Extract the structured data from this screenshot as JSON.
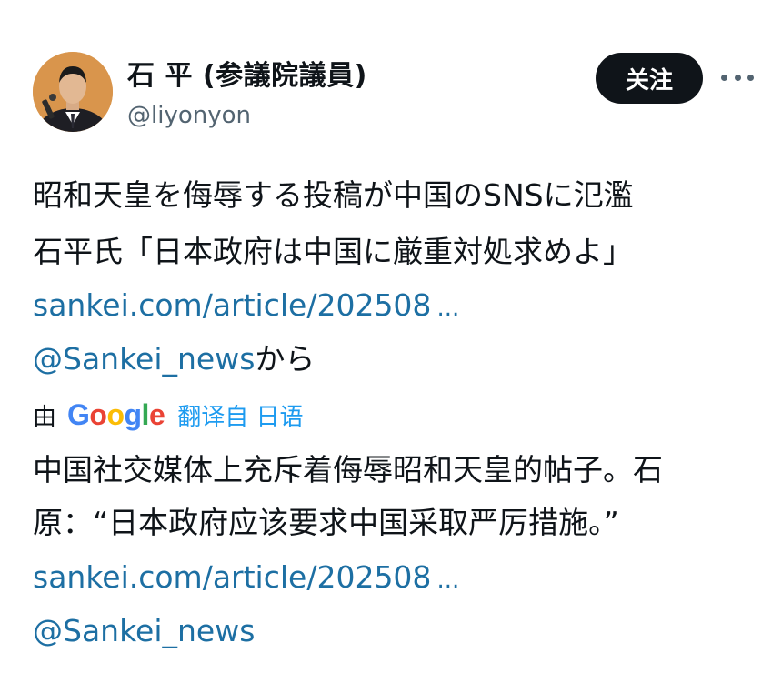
{
  "author": {
    "name": "石 平 (参議院議員)",
    "handle": "@liyonyon"
  },
  "actions": {
    "follow_label": "关注",
    "more_icon": "more-horizontal-icon"
  },
  "original": {
    "line1": "昭和天皇を侮辱する投稿が中国のSNSに氾濫",
    "line2": "石平氏「日本政府は中国に厳重対処求めよ」",
    "link": "sankei.com/article/202508",
    "link_ellipsis": "...",
    "source_mention": "@Sankei_news",
    "source_suffix": "から"
  },
  "translation": {
    "prefix": "由",
    "provider_logo": [
      "G",
      "o",
      "o",
      "g",
      "l",
      "e"
    ],
    "label": "翻译自 日语"
  },
  "translated": {
    "line1": "中国社交媒体上充斥着侮辱昭和天皇的帖子。石",
    "line2": "原：“日本政府应该要求中国采取严厉措施。”",
    "link": "sankei.com/article/202508",
    "link_ellipsis": "...",
    "source_mention": "@Sankei_news"
  },
  "colors": {
    "text": "#0f1419",
    "secondary": "#536471",
    "link": "#1d6fa3",
    "accent": "#1d9bf0",
    "button_bg": "#0f1419"
  }
}
